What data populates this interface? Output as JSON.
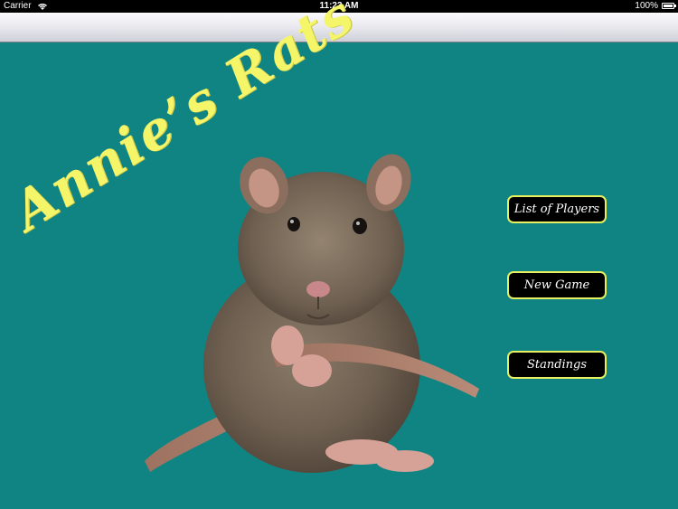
{
  "status_bar": {
    "carrier": "Carrier",
    "time": "11:23 AM",
    "battery": "100%"
  },
  "app": {
    "title": "Annie’s Rats"
  },
  "menu": {
    "list_of_players": "List of Players",
    "new_game": "New Game",
    "standings": "Standings"
  },
  "colors": {
    "background": "#0f8482",
    "title": "#f5f56a",
    "button_bg": "#000000",
    "button_border": "#e8f060"
  },
  "icons": {
    "wifi": "wifi-icon",
    "battery": "battery-icon"
  }
}
